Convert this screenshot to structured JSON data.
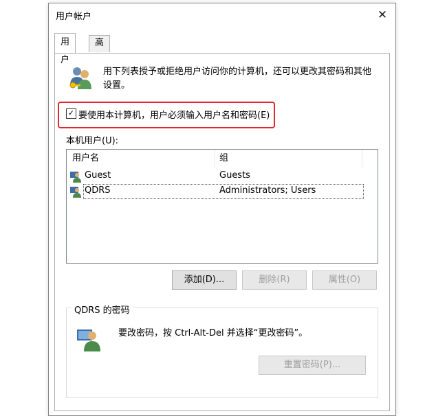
{
  "window": {
    "title": "用户帐户",
    "close_glyph": "✕"
  },
  "tabs": [
    {
      "label": "用户"
    },
    {
      "label": "高级"
    }
  ],
  "intro": {
    "text": "用下列表授予或拒绝用户访问你的计算机，还可以更改其密码和其他设置。"
  },
  "require_login": {
    "label": "要使用本计算机，用户必须输入用户名和密码(E)",
    "checked": true
  },
  "users_section": {
    "label": "本机用户(U):",
    "columns": [
      "用户名",
      "组"
    ],
    "rows": [
      {
        "name": "Guest",
        "group": "Guests",
        "icon": "user-icon"
      },
      {
        "name": "QDRS",
        "group": "Administrators; Users",
        "icon": "user-icon",
        "selected": true
      }
    ]
  },
  "actions": {
    "add": "添加(D)...",
    "remove": "删除(R)",
    "properties": "属性(O)"
  },
  "password_group": {
    "title": "QDRS 的密码",
    "text": "要改密码，按 Ctrl-Alt-Del 并选择“更改密码”。",
    "reset_button": "重置密码(P)..."
  },
  "colors": {
    "highlight_border": "#e0262c",
    "disabled_text": "#a0a0a0"
  }
}
